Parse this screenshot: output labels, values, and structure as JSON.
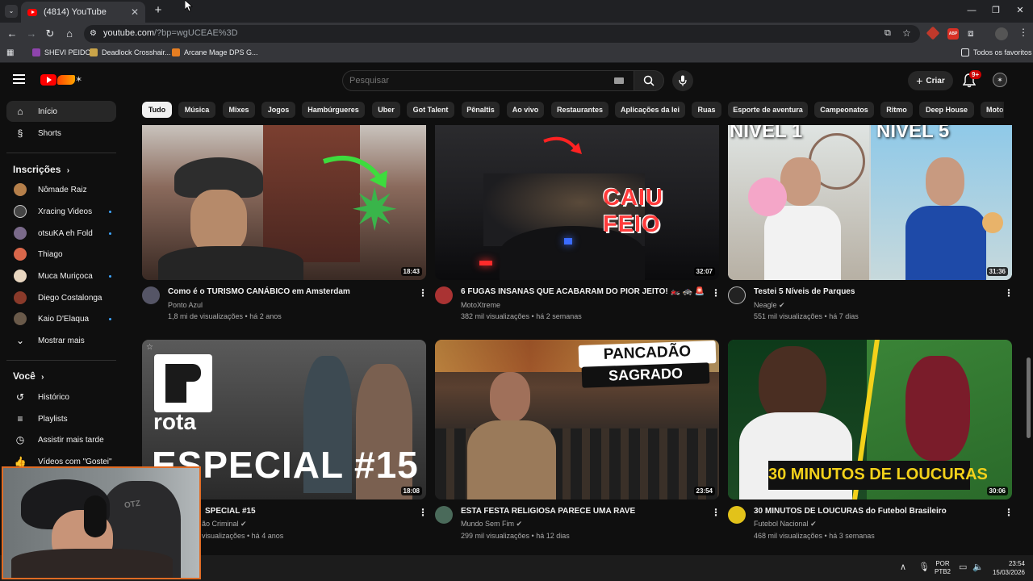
{
  "browser": {
    "tab_title": "(4814) YouTube",
    "url_host": "youtube.com",
    "url_path": "/?bp=wgUCEAE%3D",
    "bookmarks": [
      "SHEVI PEIDO",
      "Deadlock Crosshair...",
      "Arcane Mage DPS G..."
    ],
    "other_bookmarks": "Todos os favoritos",
    "ext_badge": "ABP"
  },
  "header": {
    "search_placeholder": "Pesquisar",
    "create_label": "Criar",
    "notif_count": "9+"
  },
  "chips": [
    "Tudo",
    "Música",
    "Mixes",
    "Jogos",
    "Hambúrgueres",
    "Uber",
    "Got Talent",
    "Pênaltis",
    "Ao vivo",
    "Restaurantes",
    "Aplicações da lei",
    "Ruas",
    "Esporte de aventura",
    "Campeonatos",
    "Ritmo",
    "Deep House",
    "Moto"
  ],
  "sidebar": {
    "home": "Início",
    "shorts": "Shorts",
    "subs_header": "Inscrições",
    "subs": [
      "Nômade Raiz",
      "Xracing Videos",
      "otsuKA eh Fold",
      "Thiago",
      "Muca Muriçoca",
      "Diego Costalonga",
      "Kaio D'Elaqua"
    ],
    "show_more": "Mostrar mais",
    "you_header": "Você",
    "you_items": [
      "Histórico",
      "Playlists",
      "Assistir mais tarde",
      "Vídeos com \"Gostei\""
    ]
  },
  "videos": [
    {
      "title": "Como é o TURISMO CANÁBICO em Amsterdam",
      "channel": "Ponto Azul",
      "meta": "1,8 mi de visualizações • há 2 anos",
      "duration": "18:43"
    },
    {
      "title": "6 FUGAS INSANAS QUE ACABARAM DO PIOR JEITO! 🏍️ 🚓 🚨",
      "channel": "MotoXtreme",
      "meta": "382 mil visualizações • há 2 semanas",
      "duration": "32:07",
      "overlay": "CAIU FEIO"
    },
    {
      "title": "Testei 5 Níveis de Parques",
      "channel": "Neagle",
      "meta": "551 mil visualizações • há 7 dias",
      "duration": "31:36",
      "overlay_left": "NÍVEL 1",
      "overlay_right": "NÍVEL 5"
    },
    {
      "title": "SPECIAL #15",
      "channel": "ão Criminal",
      "meta": "visualizações • há 4 anos",
      "duration": "18:08",
      "overlay_logo": "rota",
      "overlay": "ESPECIAL #15"
    },
    {
      "title": "ESTA FESTA RELIGIOSA PARECE UMA RAVE",
      "channel": "Mundo Sem Fim",
      "meta": "299 mil visualizações • há 12 dias",
      "duration": "23:54",
      "overlay_top": "PANCADÃO",
      "overlay_bottom": "SAGRADO"
    },
    {
      "title": "30 MINUTOS DE LOUCURAS do Futebol Brasileiro",
      "channel": "Futebol Nacional",
      "meta": "468 mil visualizações • há 3 semanas",
      "duration": "30:06",
      "overlay": "30 MINUTOS DE LOUCURAS"
    }
  ],
  "webcam": {
    "headrest_text": "OTZ"
  },
  "taskbar": {
    "lang1": "POR",
    "lang2": "PTB2",
    "time": "23:54",
    "date": "15/03/2026"
  },
  "colors": {
    "bg": "#0f0f0f",
    "accent_red": "#ff0000",
    "webcam_border": "#e06b24",
    "new_dot": "#3ea6ff"
  }
}
